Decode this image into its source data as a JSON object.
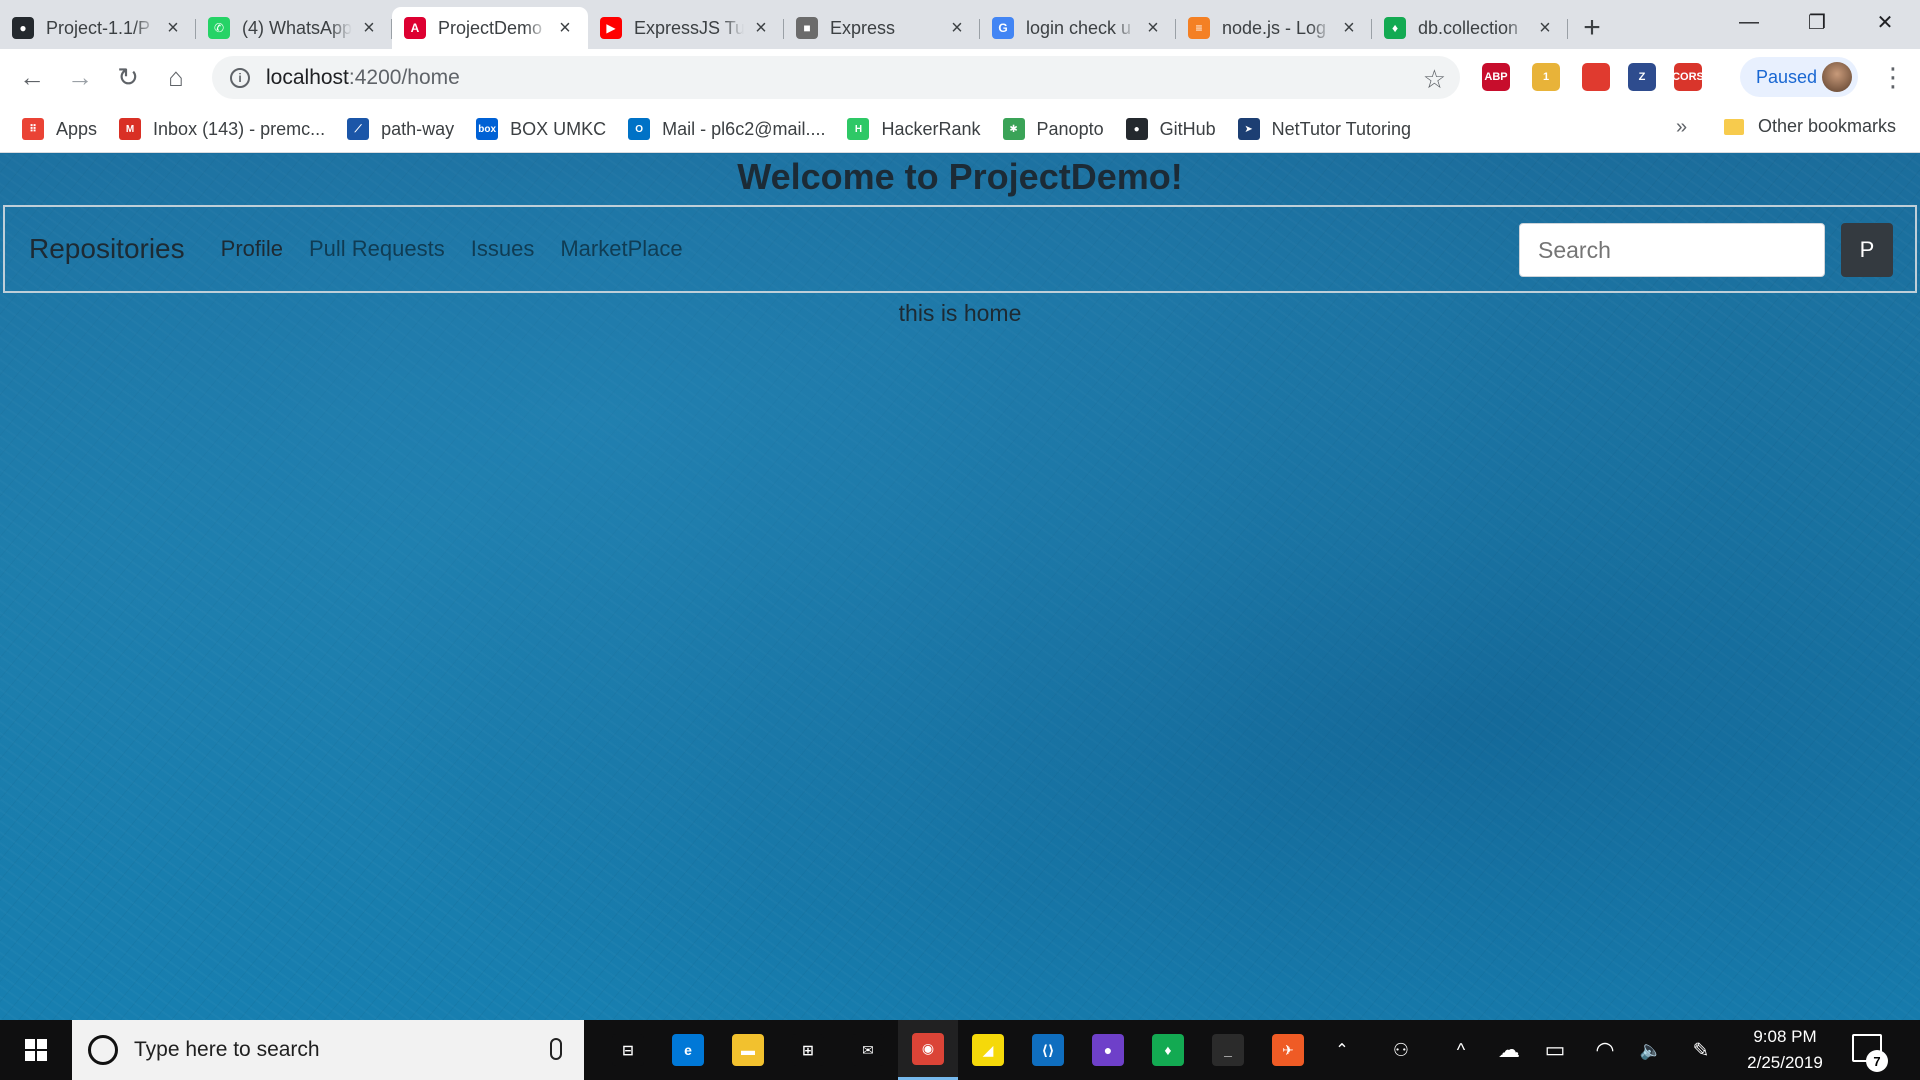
{
  "browser": {
    "tabs": [
      {
        "title": "Project-1.1/P",
        "icon": "github-icon",
        "color": "#24292e",
        "glyph": "●"
      },
      {
        "title": "(4) WhatsApp",
        "icon": "whatsapp-icon",
        "color": "#25d366",
        "glyph": "✆"
      },
      {
        "title": "ProjectDemo",
        "icon": "angular-icon",
        "color": "#dd0031",
        "glyph": "A",
        "active": true
      },
      {
        "title": "ExpressJS Tu",
        "icon": "youtube-icon",
        "color": "#ff0000",
        "glyph": "▶"
      },
      {
        "title": "Express",
        "icon": "express-robot-icon",
        "color": "#6b6b6b",
        "glyph": "■"
      },
      {
        "title": "login check u",
        "icon": "google-icon",
        "color": "#4285f4",
        "glyph": "G"
      },
      {
        "title": "node.js - Log",
        "icon": "stackoverflow-icon",
        "color": "#f48024",
        "glyph": "≡"
      },
      {
        "title": "db.collection",
        "icon": "mongodb-icon",
        "color": "#13aa52",
        "glyph": "♦"
      }
    ],
    "new_tab_glyph": "+",
    "close_glyph": "×",
    "window_controls": {
      "minimize": "—",
      "restore": "❐",
      "close": "✕"
    },
    "nav": {
      "back": "←",
      "forward": "→",
      "reload": "↻",
      "home": "⌂"
    },
    "url": {
      "host": "localhost",
      "path": ":4200/home",
      "info_glyph": "i"
    },
    "star_glyph": "☆",
    "extensions": [
      {
        "name": "adblock-plus-icon",
        "label": "ABP",
        "color": "#c70d2c"
      },
      {
        "name": "notes-extension-icon",
        "label": "1",
        "color": "#e8b339"
      },
      {
        "name": "red-book-icon",
        "label": "",
        "color": "#e03a2f"
      },
      {
        "name": "zotero-icon",
        "label": "Z",
        "color": "#2e4c8e"
      },
      {
        "name": "cors-icon",
        "label": "CORS",
        "color": "#d9352b"
      }
    ],
    "profile_status": "Paused",
    "menu_glyph": "⋮"
  },
  "bookmarks": {
    "items": [
      {
        "label": "Apps",
        "icon": "apps-grid-icon",
        "color": "#ea4335",
        "glyph": "⠿"
      },
      {
        "label": "Inbox (143) - premc...",
        "icon": "gmail-icon",
        "color": "#d93025",
        "glyph": "M"
      },
      {
        "label": "path-way",
        "icon": "path-way-icon",
        "color": "#1b56a8",
        "glyph": "⟋"
      },
      {
        "label": "BOX UMKC",
        "icon": "box-icon",
        "color": "#0061d5",
        "glyph": "box"
      },
      {
        "label": "Mail - pl6c2@mail....",
        "icon": "outlook-icon",
        "color": "#0072c6",
        "glyph": "O"
      },
      {
        "label": "HackerRank",
        "icon": "hackerrank-icon",
        "color": "#2ec866",
        "glyph": "H"
      },
      {
        "label": "Panopto",
        "icon": "panopto-icon",
        "color": "#3aa357",
        "glyph": "✱"
      },
      {
        "label": "GitHub",
        "icon": "github-icon",
        "color": "#24292e",
        "glyph": "●"
      },
      {
        "label": "NetTutor Tutoring",
        "icon": "nettutor-icon",
        "color": "#1d3f73",
        "glyph": "➤"
      }
    ],
    "more_glyph": "»",
    "other": "Other bookmarks"
  },
  "page": {
    "title": "Welcome to ProjectDemo!",
    "navbar": {
      "brand": "Repositories",
      "links": [
        "Profile",
        "Pull Requests",
        "Issues",
        "MarketPlace"
      ],
      "active_link": "Profile",
      "search_placeholder": "Search",
      "search_button": "P"
    },
    "content": "this is home"
  },
  "taskbar": {
    "search_placeholder": "Type here to search",
    "apps": [
      {
        "name": "task-view-icon",
        "glyph": "⊟",
        "color": "#0f0f10"
      },
      {
        "name": "edge-icon",
        "glyph": "e",
        "color": "#0078d7"
      },
      {
        "name": "file-explorer-icon",
        "glyph": "▬",
        "color": "#f2c12e"
      },
      {
        "name": "store-icon",
        "glyph": "⊞",
        "color": "#0f0f10"
      },
      {
        "name": "mail-icon",
        "glyph": "✉",
        "color": "#0f0f10"
      },
      {
        "name": "chrome-icon",
        "glyph": "◉",
        "color": "#db4437",
        "open": true
      },
      {
        "name": "sticky-notes-icon",
        "glyph": "◢",
        "color": "#f5d90a"
      },
      {
        "name": "vscode-icon",
        "glyph": "⟨⟩",
        "color": "#0f6ebf"
      },
      {
        "name": "github-desktop-icon",
        "glyph": "●",
        "color": "#6e40c9"
      },
      {
        "name": "mongodb-compass-icon",
        "glyph": "♦",
        "color": "#13aa52"
      },
      {
        "name": "terminal-icon",
        "glyph": "_",
        "color": "#2b2b2b"
      },
      {
        "name": "postman-icon",
        "glyph": "✈",
        "color": "#ef5b25"
      }
    ],
    "tray": {
      "chevron": "⌃",
      "people": "⚇",
      "up": "^",
      "cloud": "☁",
      "battery": "▭",
      "wifi": "◠",
      "volume": "🔈",
      "pen": "✎"
    },
    "time": "9:08 PM",
    "date": "2/25/2019",
    "notifications": "7"
  }
}
